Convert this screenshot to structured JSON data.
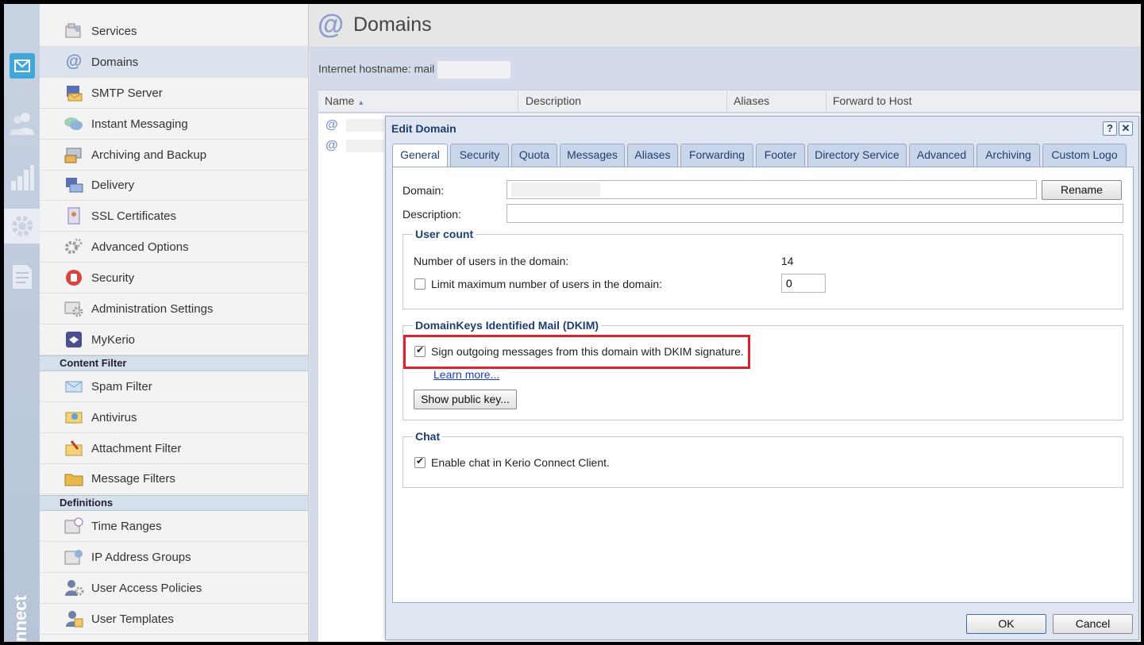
{
  "nav": {
    "items": [
      {
        "label": "Services",
        "icon": "services-icon"
      },
      {
        "label": "Domains",
        "icon": "at-icon",
        "selected": true
      },
      {
        "label": "SMTP Server",
        "icon": "smtp-server-icon"
      },
      {
        "label": "Instant Messaging",
        "icon": "chat-bubbles-icon"
      },
      {
        "label": "Archiving and Backup",
        "icon": "archive-icon"
      },
      {
        "label": "Delivery",
        "icon": "delivery-icon"
      },
      {
        "label": "SSL Certificates",
        "icon": "certificate-icon"
      },
      {
        "label": "Advanced Options",
        "icon": "gears-icon"
      },
      {
        "label": "Security",
        "icon": "stop-hand-icon"
      },
      {
        "label": "Administration Settings",
        "icon": "admin-settings-icon"
      },
      {
        "label": "MyKerio",
        "icon": "mykerio-icon"
      }
    ],
    "content_filter_title": "Content Filter",
    "content_filter_items": [
      {
        "label": "Spam Filter",
        "icon": "spam-filter-icon"
      },
      {
        "label": "Antivirus",
        "icon": "antivirus-icon"
      },
      {
        "label": "Attachment Filter",
        "icon": "attachment-filter-icon"
      },
      {
        "label": "Message Filters",
        "icon": "message-filters-icon"
      }
    ],
    "definitions_title": "Definitions",
    "definitions_items": [
      {
        "label": "Time Ranges",
        "icon": "time-ranges-icon"
      },
      {
        "label": "IP Address Groups",
        "icon": "ip-groups-icon"
      },
      {
        "label": "User Access Policies",
        "icon": "user-access-icon"
      },
      {
        "label": "User Templates",
        "icon": "user-templates-icon"
      }
    ]
  },
  "rail": {
    "brand": "nnect"
  },
  "main": {
    "at_symbol": "@",
    "title": "Domains",
    "hostname_label": "Internet hostname: mail",
    "columns": [
      "Name",
      "Description",
      "Aliases",
      "Forward to Host"
    ]
  },
  "dialog": {
    "title": "Edit Domain",
    "help": "?",
    "close": "✕",
    "tabs": [
      "General",
      "Security",
      "Quota",
      "Messages",
      "Aliases",
      "Forwarding",
      "Footer",
      "Directory Service",
      "Advanced",
      "Archiving",
      "Custom Logo"
    ],
    "active_tab": "General",
    "domain_label": "Domain:",
    "rename_label": "Rename",
    "description_label": "Description:",
    "description_value": "",
    "user_count": {
      "title": "User count",
      "users_label": "Number of users in the domain:",
      "users_value": "14",
      "limit_label": "Limit maximum number of users in the domain:",
      "limit_checked": false,
      "limit_value": "0"
    },
    "dkim": {
      "title": "DomainKeys Identified Mail (DKIM)",
      "sign_label": "Sign outgoing messages from this domain with DKIM signature.",
      "sign_checked": true,
      "learn_more": "Learn more...",
      "show_key": "Show public key..."
    },
    "chat": {
      "title": "Chat",
      "enable_label": "Enable chat in Kerio Connect Client.",
      "enable_checked": true
    },
    "ok_label": "OK",
    "cancel_label": "Cancel"
  },
  "colors": {
    "highlight": "#e0202c",
    "accent": "#1d3f70",
    "link": "#1a3fbf"
  }
}
